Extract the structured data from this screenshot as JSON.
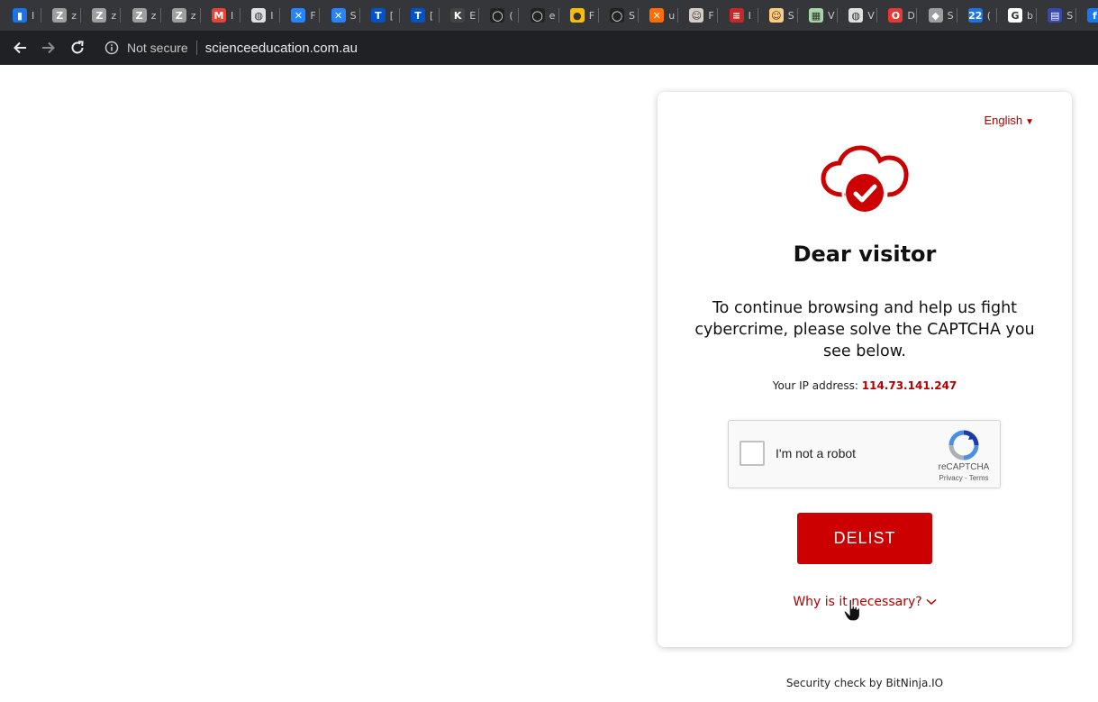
{
  "browser": {
    "tabs": [
      {
        "icon": "bar-chart-icon",
        "color": "#1a73e8",
        "glyph": "▮",
        "label": "I"
      },
      {
        "icon": "z-icon",
        "color": "#9e9e9e",
        "glyph": "Z",
        "label": "z"
      },
      {
        "icon": "z-icon",
        "color": "#9e9e9e",
        "glyph": "Z",
        "label": "z"
      },
      {
        "icon": "z-icon",
        "color": "#9e9e9e",
        "glyph": "Z",
        "label": "z"
      },
      {
        "icon": "z-icon",
        "color": "#9e9e9e",
        "glyph": "Z",
        "label": "z"
      },
      {
        "icon": "gmail-icon",
        "color": "#ea4335",
        "glyph": "M",
        "label": "I"
      },
      {
        "icon": "globe-icon",
        "color": "#e0e0e0",
        "glyph": "◍",
        "label": "I"
      },
      {
        "icon": "confluence-icon",
        "color": "#2684ff",
        "glyph": "✕",
        "label": "F"
      },
      {
        "icon": "confluence-icon",
        "color": "#2684ff",
        "glyph": "✕",
        "label": "S"
      },
      {
        "icon": "trello-icon",
        "color": "#0052cc",
        "glyph": "T",
        "label": "["
      },
      {
        "icon": "trello-icon",
        "color": "#0052cc",
        "glyph": "T",
        "label": "["
      },
      {
        "icon": "k-icon",
        "color": "#444",
        "glyph": "K",
        "label": "E"
      },
      {
        "icon": "github-icon",
        "color": "#222",
        "glyph": "◯",
        "label": "("
      },
      {
        "icon": "github-icon",
        "color": "#222",
        "glyph": "◯",
        "label": "e"
      },
      {
        "icon": "lightbulb-icon",
        "color": "#fbbc04",
        "glyph": "●",
        "label": "F"
      },
      {
        "icon": "github-icon",
        "color": "#222",
        "glyph": "◯",
        "label": "S"
      },
      {
        "icon": "x-icon",
        "color": "#ff6d00",
        "glyph": "✕",
        "label": "u"
      },
      {
        "icon": "avatar-icon",
        "color": "#d7ccc8",
        "glyph": "☺",
        "label": "F"
      },
      {
        "icon": "list-icon",
        "color": "#c62828",
        "glyph": "≡",
        "label": "I"
      },
      {
        "icon": "avatar-icon",
        "color": "#ffcc80",
        "glyph": "☺",
        "label": "S"
      },
      {
        "icon": "grid-icon",
        "color": "#a5d6a7",
        "glyph": "▦",
        "label": "V"
      },
      {
        "icon": "globe-icon",
        "color": "#e0e0e0",
        "glyph": "◍",
        "label": "V"
      },
      {
        "icon": "opera-icon",
        "color": "#e53935",
        "glyph": "O",
        "label": "D"
      },
      {
        "icon": "shield-icon",
        "color": "#9e9e9e",
        "glyph": "◆",
        "label": "S"
      },
      {
        "icon": "calendar-icon",
        "color": "#1a73e8",
        "glyph": "22",
        "label": "("
      },
      {
        "icon": "google-icon",
        "color": "#ffffff",
        "glyph": "G",
        "label": "b"
      },
      {
        "icon": "terminal-icon",
        "color": "#3949ab",
        "glyph": "▤",
        "label": "S"
      },
      {
        "icon": "facebook-icon",
        "color": "#1877f2",
        "glyph": "f",
        "label": ""
      }
    ],
    "security_label": "Not secure",
    "url": "scienceeducation.com.au"
  },
  "page": {
    "language": "English",
    "title": "Dear visitor",
    "description": "To continue browsing and help us fight cybercrime, please solve the CAPTCHA you see below.",
    "ip_label": "Your IP address:",
    "ip_value": "114.73.141.247",
    "recaptcha": {
      "label": "I'm not a robot",
      "brand": "reCAPTCHA",
      "links": "Privacy - Terms"
    },
    "delist_label": "DELIST",
    "why_label": "Why is it necessary?",
    "footer": "Security check by BitNinja.IO"
  },
  "colors": {
    "accent": "#cc0000",
    "link": "#b30000"
  }
}
